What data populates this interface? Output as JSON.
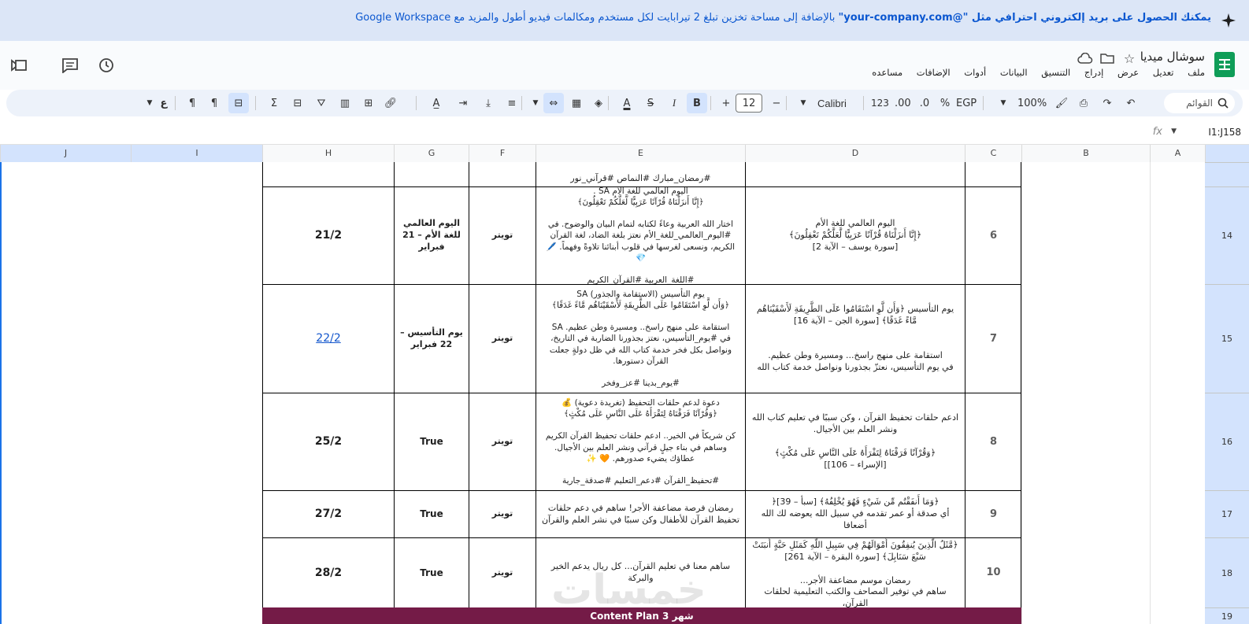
{
  "banner": {
    "bold_part": "يمكنك الحصول على بريد إلكتروني احترافي مثل \"@your-company.com\"",
    "rest": " بالإضافة إلى مساحة تخزين تبلغ 2 تيرابايت لكل مستخدم ومكالمات فيديو أطول والمزيد مع Google Workspace"
  },
  "header": {
    "title": "سوشال ميديا",
    "menu": [
      "ملف",
      "تعديل",
      "عرض",
      "إدراج",
      "التنسيق",
      "البيانات",
      "أدوات",
      "الإضافات",
      "مساعده"
    ]
  },
  "toolbar": {
    "search_placeholder": "القوائم",
    "zoom": "100%",
    "currency": "EGP",
    "percent": "%",
    "dec_less": ".0",
    "dec_more": ".00",
    "number_format": "123",
    "font": "Calibri",
    "font_size": "12",
    "minus": "−",
    "plus": "+",
    "bold": "B",
    "italic": "I",
    "strike": "S",
    "text_color": "A",
    "more": "ع"
  },
  "formula_bar": {
    "name_box": "I1:J158",
    "fx": "fx"
  },
  "columns": [
    "A",
    "B",
    "C",
    "D",
    "E",
    "F",
    "G",
    "H",
    "I",
    "J"
  ],
  "rows": [
    {
      "row_no": "",
      "c": "",
      "d": "",
      "e": "#رمضان_مبارك #النماص #قرآني_نور",
      "f": "",
      "g": "",
      "h": ""
    },
    {
      "row_no": "14",
      "c": "6",
      "d": "اليوم العالمي للغة الأم\n﴿إِنَّا أَنزَلْنَاهُ قُرْآنًا عَرَبِيًّا لَّعَلَّكُمْ تَعْقِلُونَ﴾\n[سورة يوسف – الآية 2]",
      "e": "اليوم العالمي للغة الأم SA .\n﴿إِنَّا أَنزَلْنَاهُ قُرْآنًا عَرَبِيًّا لَّعَلَّكُمْ تَعْقِلُونَ﴾\n\nاختار الله العربية وعاءً لكتابه لتمام البيان والوضوح. في #اليوم_العالمي_للغة_الأم نعتز بلغة الضاد، لغة القرآن الكريم، ونسعى لغرسها في قلوب أبنائنا تلاوةً وفهماً. 🖊️ 💎\n\n#اللغة_العربية #القرآن_الكريم",
      "f": "تويتر",
      "g": "اليوم العالمي للغة الأم – 21 فبراير",
      "h": "21/2"
    },
    {
      "row_no": "15",
      "c": "7",
      "d": "يوم التأسيس ﴿وَأَن لَّوِ اسْتَقَامُوا عَلَى الطَّرِيقَةِ لَأَسْقَيْنَاهُم مَّاءً غَدَقًا﴾ [سورة الجن – الآية 16]\n\n\nاستقامة على منهج راسخ... ومسيرة وطن عظيم.\nفي يوم التأسيس، نعتزّ بجذورنا ونواصل خدمة كتاب الله",
      "e": "يوم التأسيس (الاستقامة والجذور) SA\n﴿وَأَن لَّوِ اسْتَقَامُوا عَلَى الطَّرِيقَةِ لَأَسْقَيْنَاهُم مَّاءً غَدَقًا﴾\n\nاستقامة على منهج راسخ.. ومسيرة وطن عظيم. SA\nفي #يوم_التأسيس، نعتز بجذورنا الضاربة في التاريخ، ونواصل بكل فخر خدمة كتاب الله في ظل دولةٍ جعلت القرآن دستورها.\n\n#يوم_بدينا #عز_وفخر",
      "f": "تويتر",
      "g": "يوم التأسيس – 22 فبراير",
      "h": "22/2"
    },
    {
      "row_no": "16",
      "c": "8",
      "d": "ادعم حلقات تحفيظ القرآن ، وكن سببًا في تعليم كتاب الله ونشر العلم بين الأجيال.\n\n﴿وَقُرْآنًا فَرَقْنَاهُ لِتَقْرَأَهُ عَلَى النَّاسِ عَلَى مُكْثٍ﴾\n[الإسراء – 106]]",
      "e": "دعوة لدعم حلقات التحفيظ (تغريدة دعوية) 💰\n﴿وَقُرْآنًا فَرَقْنَاهُ لِتَقْرَأَهُ عَلَى النَّاسِ عَلَى مُكْثٍ﴾\n\nكن شريكاً في الخير.. ادعم حلقات تحفيظ القرآن الكريم وساهم في بناء جيلٍ قرآني ونشر العلم بين الأجيال. عطاؤك يضيء صدورهم. 🧡 ✨\n\n#تحفيظ_القرآن #دعم_التعليم #صدقة_جارية",
      "f": "تويتر",
      "g": "True",
      "h": "25/2"
    },
    {
      "row_no": "17",
      "c": "9",
      "d": "﴿وَمَا أَنفَقْتُم مِّن شَيْءٍ فَهُوَ يُخْلِفُهُ﴾ [سبأ – 39]﴿\nأي صدقة أو عمر تقدمه في سبيل الله يعوضه لك الله أضعافا",
      "e": "رمضان فرصة مضاعفة الأجر! ساهم في دعم حلقات تحفيظ القرآن للأطفال وكن سببًا في نشر العلم والقرآن",
      "f": "تويتر",
      "g": "True",
      "h": "27/2"
    },
    {
      "row_no": "18",
      "c": "10",
      "d": "﴿مَّثَلُ الَّذِينَ يُنفِقُونَ أَمْوَالَهُمْ فِي سَبِيلِ اللَّهِ كَمَثَلِ حَبَّةٍ أَنبَتَتْ سَبْعَ سَنَابِلَ﴾ [سورة البقرة – الآية 261]\n\nرمضان موسم مضاعفة الأجر...\nساهم في توفير المصاحف والكتب التعليمية لحلقات القرآن،",
      "e": "ساهم معنا في تعليم القرآن... كل ريال يدعم الخير والبركة",
      "f": "تويتر",
      "g": "True",
      "h": "28/2"
    }
  ],
  "row19": "19",
  "purple_bar": "شهر 3  Content Plan",
  "watermark": "خمسات"
}
